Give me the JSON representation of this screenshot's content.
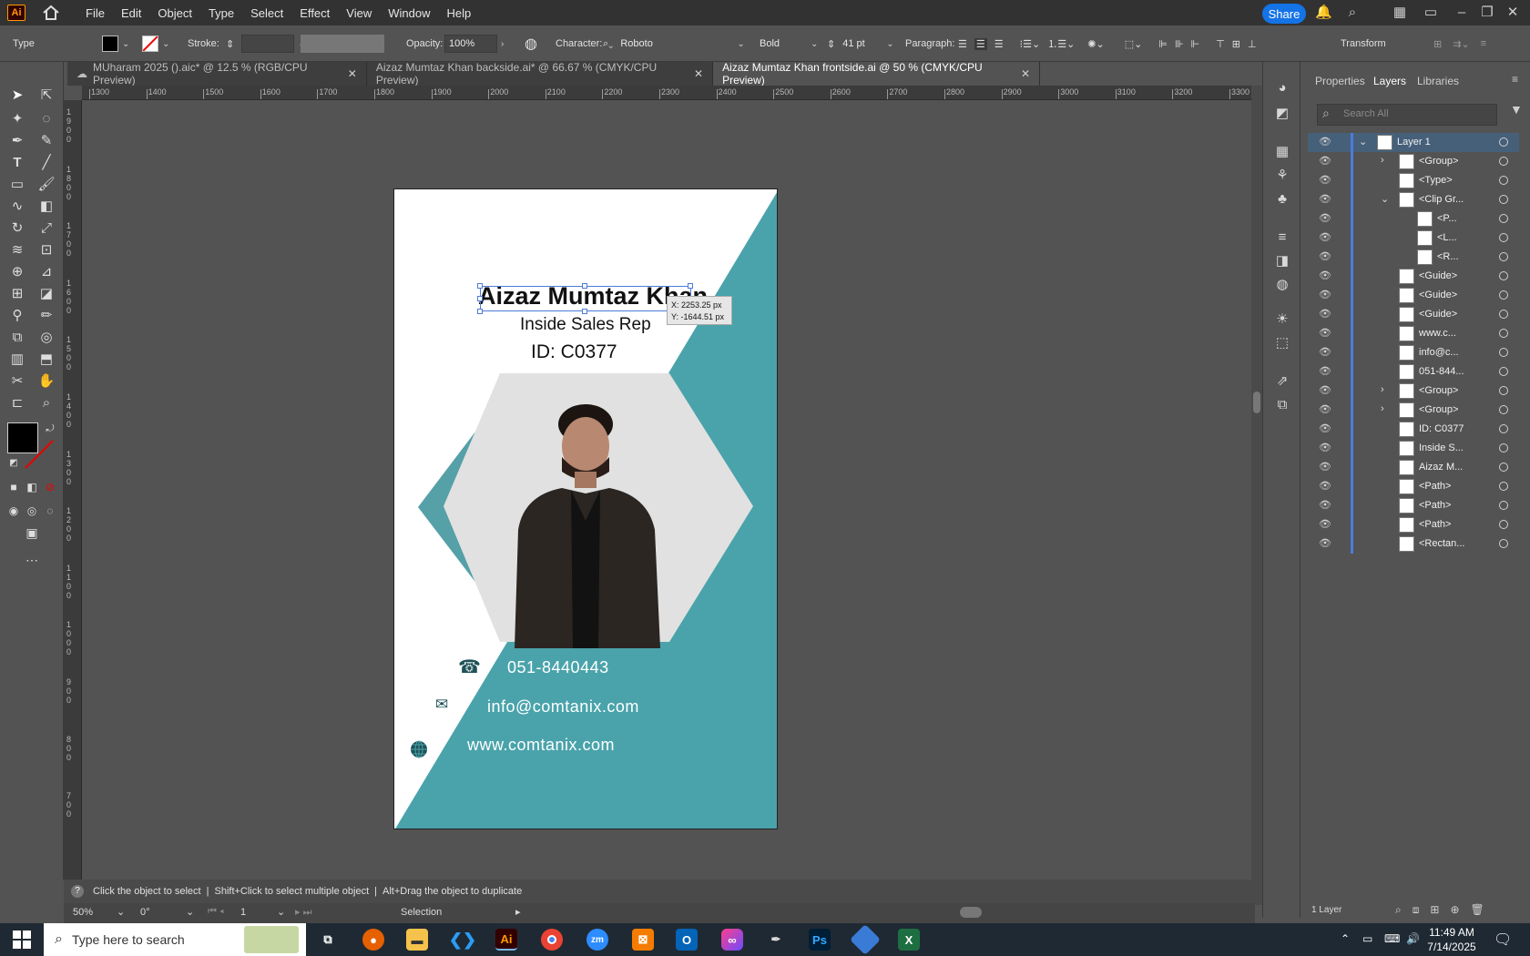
{
  "menubar": {
    "app_logo": "Ai",
    "items": [
      "File",
      "Edit",
      "Object",
      "Type",
      "Select",
      "Effect",
      "View",
      "Window",
      "Help"
    ],
    "share_label": "Share"
  },
  "controlbar": {
    "tool_label": "Type",
    "stroke_label": "Stroke:",
    "opacity_label": "Opacity:",
    "opacity_value": "100%",
    "character_label": "Character:",
    "font_family": "Roboto",
    "font_style": "Bold",
    "font_size": "41 pt",
    "paragraph_label": "Paragraph:",
    "transform_label": "Transform"
  },
  "tabs": [
    {
      "label": "MUharam 2025 ().aic* @ 12.5 % (RGB/CPU Preview)"
    },
    {
      "label": "Aizaz Mumtaz Khan backside.ai* @ 66.67 % (CMYK/CPU Preview)"
    },
    {
      "label": "Aizaz Mumtaz Khan frontside.ai @ 50 % (CMYK/CPU Preview)"
    }
  ],
  "ruler": {
    "h_labels": [
      "1300",
      "1400",
      "1500",
      "1600",
      "1700",
      "1800",
      "1900",
      "2000",
      "2100",
      "2200",
      "2300",
      "2400",
      "2500",
      "2600",
      "2700",
      "2800",
      "2900",
      "3000",
      "3100",
      "3200",
      "3300"
    ],
    "v_labels": [
      "1900",
      "1800",
      "1700",
      "1600",
      "1500",
      "1400",
      "1300",
      "1200",
      "1100",
      "1000",
      "900",
      "800",
      "700"
    ]
  },
  "card": {
    "name": "Aizaz Mumtaz Khan",
    "title": "Inside Sales Rep",
    "id": "ID: C0377",
    "phone": "051-8440443",
    "email": "info@comtanix.com",
    "website": "www.comtanix.com",
    "teal": "#4aa3ab",
    "hex_bg": "#e1e1e1"
  },
  "tooltip": {
    "x": "X: 2253.25 px",
    "y": "Y: -1644.51 px"
  },
  "panel": {
    "tabs": [
      "Properties",
      "Layers",
      "Libraries"
    ],
    "search_placeholder": "Search All",
    "layers": [
      {
        "name": "Layer 1"
      },
      {
        "name": "<Group>"
      },
      {
        "name": "<Type>"
      },
      {
        "name": "<Clip Gr..."
      },
      {
        "name": "<P..."
      },
      {
        "name": "<L..."
      },
      {
        "name": "<R..."
      },
      {
        "name": "<Guide>"
      },
      {
        "name": "<Guide>"
      },
      {
        "name": "<Guide>"
      },
      {
        "name": "www.c..."
      },
      {
        "name": "info@c..."
      },
      {
        "name": "051-844..."
      },
      {
        "name": "<Group>"
      },
      {
        "name": "<Group>"
      },
      {
        "name": "ID: C0377"
      },
      {
        "name": "Inside S..."
      },
      {
        "name": "Aizaz M..."
      },
      {
        "name": "<Path>"
      },
      {
        "name": "<Path>"
      },
      {
        "name": "<Path>"
      },
      {
        "name": "<Rectan..."
      }
    ],
    "footer": "1 Layer"
  },
  "status": {
    "hint_1": "Click the object to select",
    "hint_2": "Shift+Click to select multiple object",
    "hint_3": "Alt+Drag the object to duplicate",
    "zoom": "50%",
    "rotation": "0°",
    "artboard": "1",
    "mode": "Selection"
  },
  "taskbar": {
    "search_placeholder": "Type here to search",
    "time": "11:49 AM",
    "date": "7/14/2025"
  }
}
